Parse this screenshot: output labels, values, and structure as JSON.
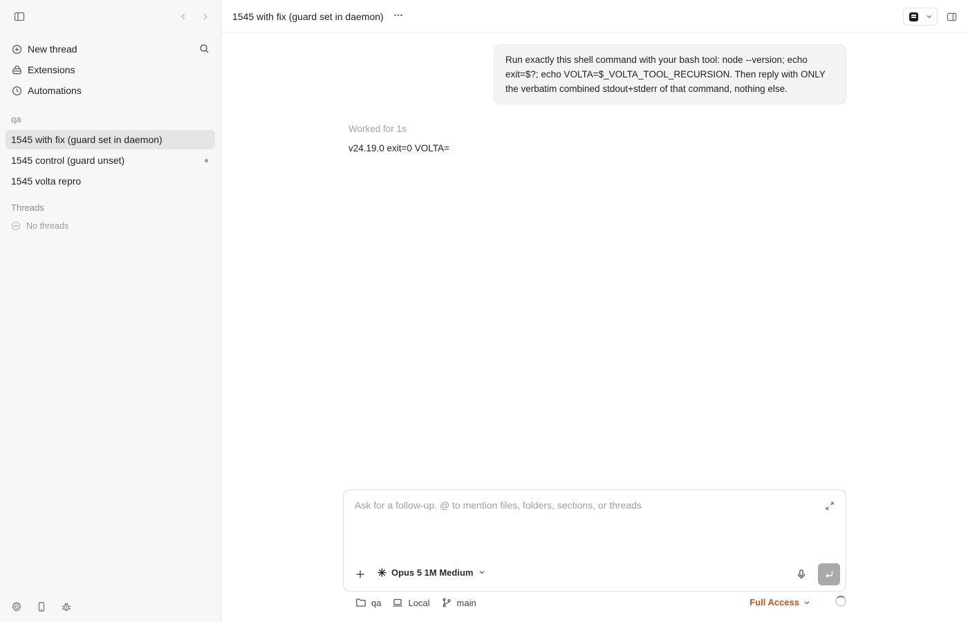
{
  "sidebar": {
    "menu": [
      {
        "label": "New thread",
        "icon": "plus-circle-icon"
      },
      {
        "label": "Extensions",
        "icon": "extensions-icon"
      },
      {
        "label": "Automations",
        "icon": "clock-icon"
      }
    ],
    "project_label": "qa",
    "project_threads": [
      {
        "label": "1545 with fix (guard set in daemon)",
        "active": true
      },
      {
        "label": "1545 control (guard unset)",
        "unread": true
      },
      {
        "label": "1545 volta repro"
      }
    ],
    "threads_label": "Threads",
    "no_threads": "No threads"
  },
  "header": {
    "title": "1545 with fix (guard set in daemon)"
  },
  "conversation": {
    "user_message": "Run exactly this shell command with your bash tool: node --version; echo exit=$?; echo VOLTA=$_VOLTA_TOOL_RECURSION. Then reply with ONLY the verbatim combined stdout+stderr of that command, nothing else.",
    "worked_status": "Worked for 1s",
    "assistant_reply": "v24.19.0 exit=0 VOLTA="
  },
  "composer": {
    "placeholder": "Ask for a follow-up. @ to mention files, folders, sections, or threads",
    "model": "Opus 5 1M Medium"
  },
  "footer": {
    "folder": "qa",
    "environment": "Local",
    "branch": "main",
    "access": "Full Access"
  },
  "colors": {
    "accent_access": "#c0561b",
    "active_thread_bg": "#e4e4e4",
    "sidebar_bg": "#f7f7f7"
  }
}
